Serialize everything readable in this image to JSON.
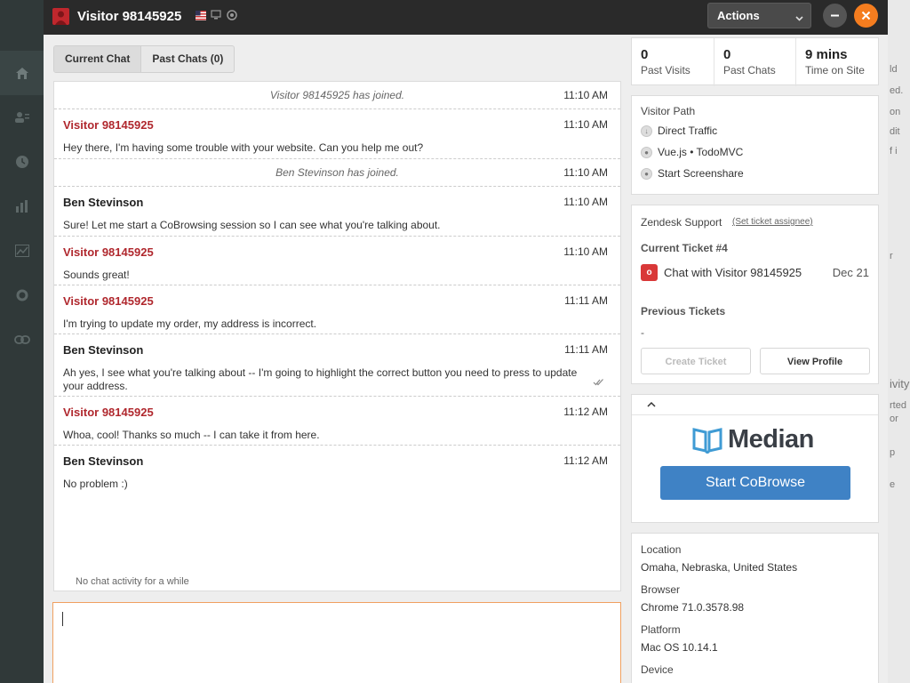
{
  "window": {
    "title": "Visitor 98145925",
    "actions_label": "Actions"
  },
  "tabs": [
    {
      "label": "Current Chat"
    },
    {
      "label": "Past Chats (0)"
    }
  ],
  "chat": {
    "messages": [
      {
        "kind": "system",
        "text": "Visitor 98145925 has joined.",
        "time": "11:10 AM"
      },
      {
        "kind": "visitor",
        "author": "Visitor 98145925",
        "time": "11:10 AM",
        "text": "Hey there, I'm having some trouble with your website. Can you help me out?"
      },
      {
        "kind": "system",
        "text": "Ben Stevinson has joined.",
        "time": "11:10 AM"
      },
      {
        "kind": "agent",
        "author": "Ben Stevinson",
        "time": "11:10 AM",
        "text": "Sure! Let me start a CoBrowsing session so I can see what you're talking about."
      },
      {
        "kind": "visitor",
        "author": "Visitor 98145925",
        "time": "11:10 AM",
        "text": "Sounds great!"
      },
      {
        "kind": "visitor",
        "author": "Visitor 98145925",
        "time": "11:11 AM",
        "text": "I'm trying to update my order, my address is incorrect."
      },
      {
        "kind": "agent",
        "author": "Ben Stevinson",
        "time": "11:11 AM",
        "text": "Ah yes, I see what you're talking about -- I'm going to highlight the correct button you need to press to update your address."
      },
      {
        "kind": "visitor",
        "author": "Visitor 98145925",
        "time": "11:12 AM",
        "text": "Whoa, cool! Thanks so much -- I can take it from here."
      },
      {
        "kind": "agent",
        "author": "Ben Stevinson",
        "time": "11:12 AM",
        "text": "No problem :)"
      }
    ],
    "idle_text": "No chat activity for a while"
  },
  "stats": [
    {
      "value": "0",
      "label": "Past Visits"
    },
    {
      "value": "0",
      "label": "Past Chats"
    },
    {
      "value": "9 mins",
      "label": "Time on Site"
    }
  ],
  "visitor_path": {
    "title": "Visitor Path",
    "items": [
      "Direct Traffic",
      "Vue.js • TodoMVC",
      "Start Screenshare"
    ]
  },
  "zendesk": {
    "title": "Zendesk Support",
    "assignee_link": "(Set ticket assignee)",
    "current_ticket_label": "Current Ticket #4",
    "ticket_badge": "o",
    "ticket_name": "Chat with Visitor 98145925",
    "ticket_date": "Dec 21",
    "previous_label": "Previous Tickets",
    "previous_value": "-",
    "create_ticket": "Create Ticket",
    "view_profile": "View Profile"
  },
  "cobrowse": {
    "brand": "Median",
    "button": "Start CoBrowse"
  },
  "info": {
    "location_label": "Location",
    "location_value": "Omaha, Nebraska, United States",
    "browser_label": "Browser",
    "browser_value": "Chrome 71.0.3578.98",
    "platform_label": "Platform",
    "platform_value": "Mac OS 10.14.1",
    "device_label": "Device"
  },
  "background_right": {
    "fragments": [
      "ld",
      "ed.",
      "on",
      "dit",
      "f i",
      "r",
      "ivity",
      "rted",
      "or",
      "p",
      "e"
    ]
  },
  "colors": {
    "visitor_name": "#b0282e",
    "accent_orange": "#f57d1f",
    "cobrowse_blue": "#3f82c5",
    "ticket_red": "#d93838"
  }
}
